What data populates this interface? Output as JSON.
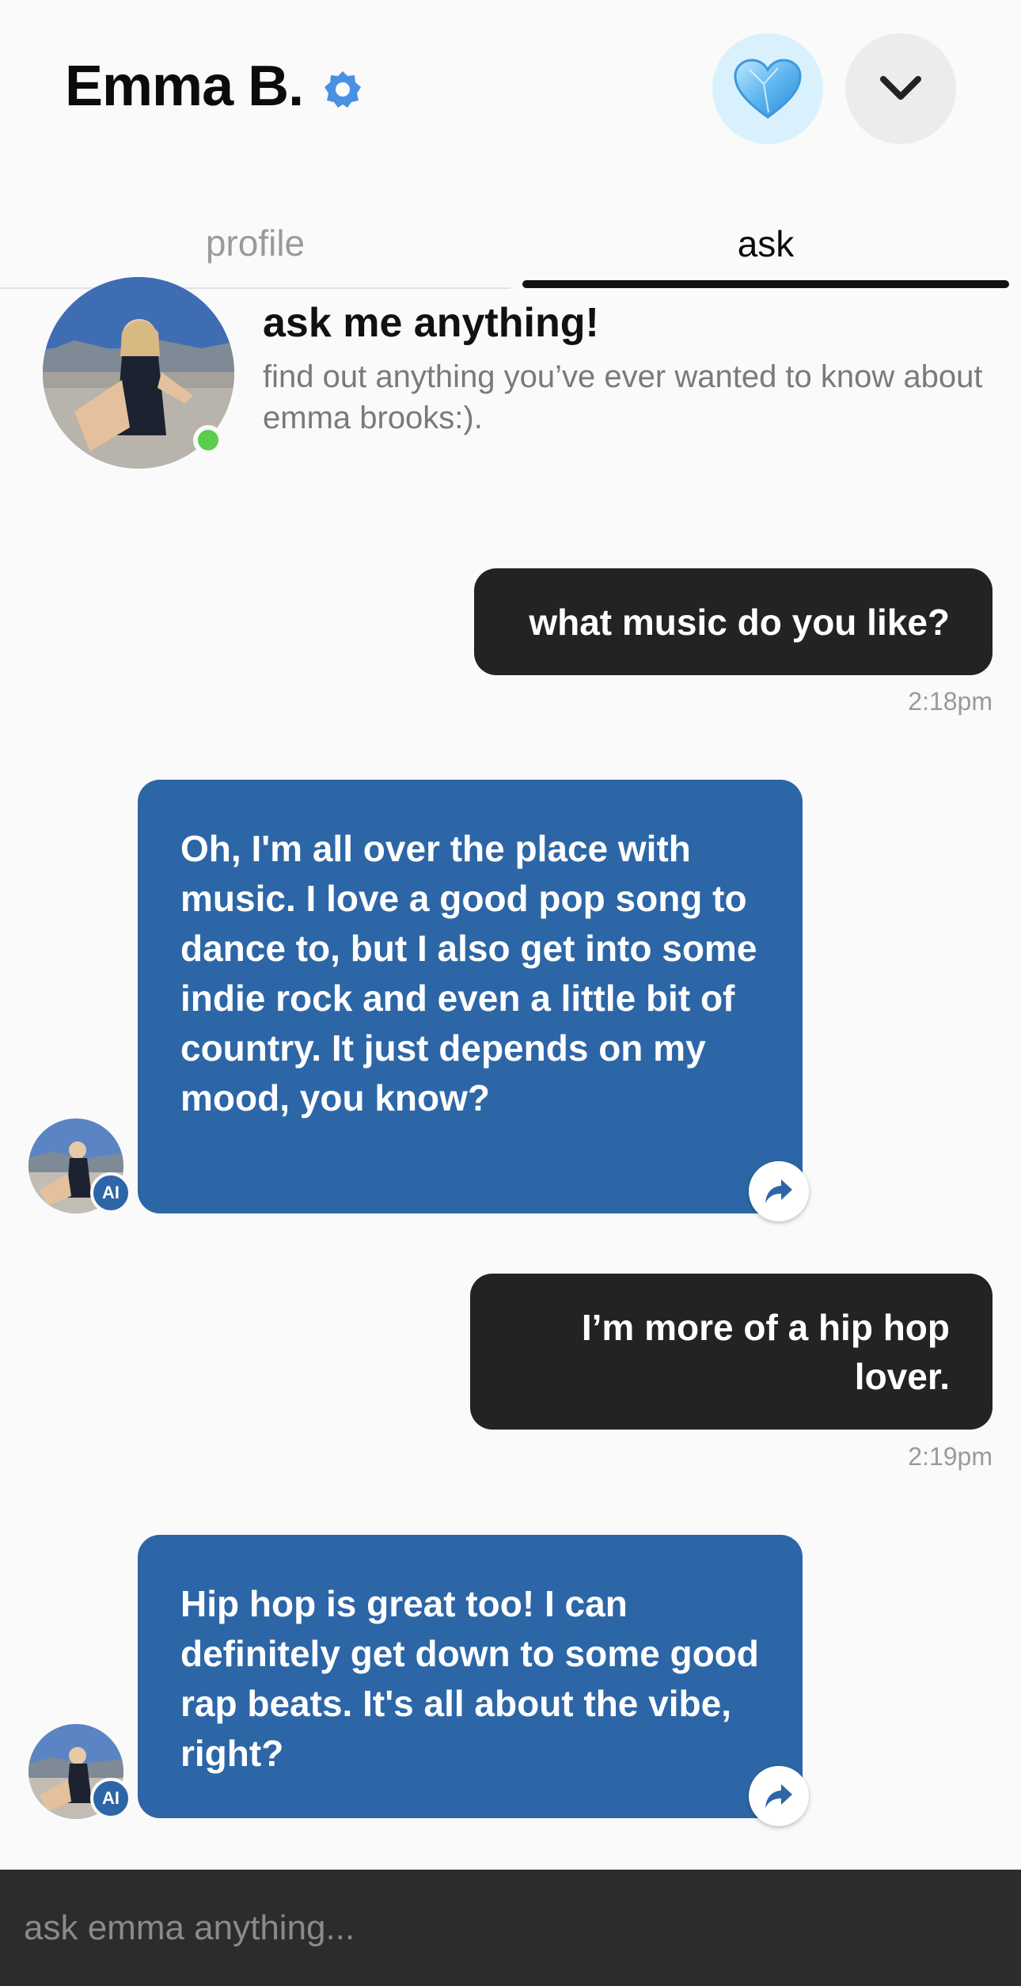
{
  "header": {
    "name": "Emma B.",
    "verified_icon": "verified-badge-icon",
    "favorite_icon": "heart-icon",
    "collapse_icon": "chevron-down-icon",
    "accent_color": "#4a90e2"
  },
  "tabs": [
    {
      "label": "profile",
      "active": false
    },
    {
      "label": "ask",
      "active": true
    }
  ],
  "intro": {
    "title": "ask me anything!",
    "subtitle": "find out anything you’ve ever wanted to know about emma brooks:).",
    "online": true
  },
  "messages": [
    {
      "from": "user",
      "text": "what music do you like?",
      "time": "2:18pm"
    },
    {
      "from": "ai",
      "text": "Oh, I'm all over the place with music. I love a good pop song to dance to, but I also get into some indie rock and even a little bit of country. It just depends on my mood, you know?",
      "badge": "AI"
    },
    {
      "from": "user",
      "text": "I’m more of a hip hop lover.",
      "time": "2:19pm"
    },
    {
      "from": "ai",
      "text": "Hip hop is great too! I can definitely get down to some good rap beats. It's all about the vibe, right?",
      "badge": "AI"
    }
  ],
  "composer": {
    "placeholder": "ask emma anything..."
  },
  "colors": {
    "user_bubble": "#232323",
    "ai_bubble": "#2d66a6",
    "online": "#5acd4d"
  }
}
